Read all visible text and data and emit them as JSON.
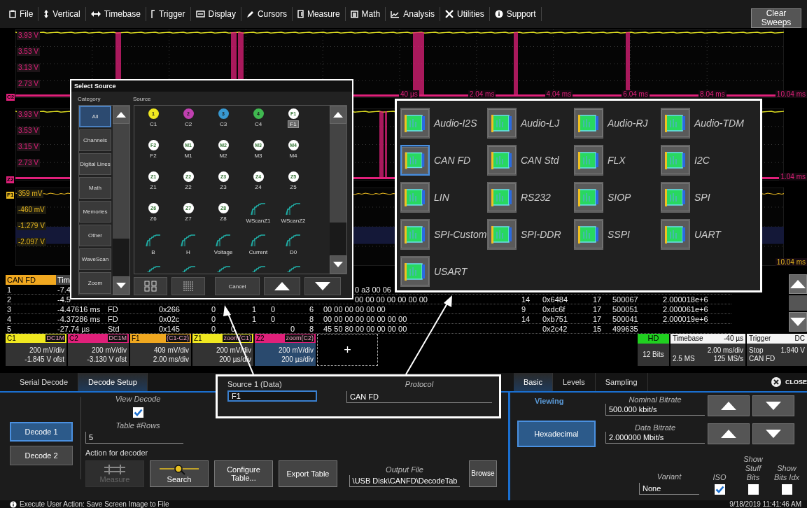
{
  "menu": {
    "items": [
      {
        "label": "File"
      },
      {
        "label": "Vertical"
      },
      {
        "label": "Timebase"
      },
      {
        "label": "Trigger"
      },
      {
        "label": "Display"
      },
      {
        "label": "Cursors"
      },
      {
        "label": "Measure"
      },
      {
        "label": "Math"
      },
      {
        "label": "Analysis"
      },
      {
        "label": "Utilities"
      },
      {
        "label": "Support"
      }
    ],
    "clear_button": "Clear Sweeps"
  },
  "scope": {
    "grids": [
      {
        "marker": "C2",
        "color": "#e0207a",
        "levels": [
          "3.93 V",
          "3.53 V",
          "3.13 V",
          "2.73 V"
        ],
        "time_labels": [
          "40 µs",
          "2.04 ms",
          "4.04 ms",
          "6.04 ms",
          "8.04 ms",
          "10.04 ms"
        ]
      },
      {
        "marker": "Z2",
        "color": "#e0207a",
        "levels": [
          "3.93 V",
          "3.53 V",
          "3.15 V",
          "2.73 V"
        ],
        "time_labels": [
          "1.04 ms"
        ]
      },
      {
        "marker": "F1",
        "color": "#e8b820",
        "levels": [
          "359 mV",
          "-460 mV",
          "-1.279 V",
          "-2.097 V"
        ],
        "time_labels": [
          "10.04 ms"
        ]
      }
    ]
  },
  "decode_table": {
    "columns": [
      "CAN FD",
      "Tim"
    ],
    "rows": [
      {
        "column_1": "1",
        "column_2": "-7.4",
        "column_11": "0 a3 00 06",
        "partly_covered": true
      },
      {
        "column_1": "2",
        "column_2": "-4.5",
        "column_11": "00 00 00 00 00 00 00",
        "column_12": "14",
        "column_13": "0x6484",
        "column_14": "17",
        "column_15": "500067",
        "column_16": "2.000018e+6",
        "partly_covered": true
      },
      {
        "column_1": "3",
        "column_2": "-4.47616 ms",
        "column_3": "FD",
        "column_4": "0x266",
        "column_5": "0",
        "column_7": "1",
        "column_8": "0",
        "column_10": "6",
        "column_11": "00 00 00 00 00 00",
        "column_12": "9",
        "column_13": "0xdc6f",
        "column_14": "17",
        "column_15": "500051",
        "column_16": "2.000061e+6",
        "partly_covered": false
      },
      {
        "column_1": "4",
        "column_2": "-4.37286 ms",
        "column_3": "FD",
        "column_4": "0x02c",
        "column_5": "0",
        "column_7": "1",
        "column_8": "0",
        "column_10": "8",
        "column_11": "00 00 00 00 00 00 00 00",
        "column_12": "14",
        "column_13": "0xb751",
        "column_14": "17",
        "column_15": "500041",
        "column_16": "2.000019e+6",
        "partly_covered": false
      },
      {
        "column_1": "5",
        "column_2": "-27.74 µs",
        "column_3": "Std",
        "column_4": "0x145",
        "column_5": "0",
        "column_6": "0",
        "column_9": "0",
        "column_10": "8",
        "column_11": "45 50 80 00 00 00 00 00",
        "column_13": "0x2c42",
        "column_14": "15",
        "column_15": "499635",
        "partly_covered": false
      }
    ]
  },
  "traces": [
    {
      "label": "C1",
      "tag": "DC1M",
      "lines": [
        "200 mV/div",
        "-1.845 V ofst"
      ],
      "color": "#f0e820",
      "selected": false
    },
    {
      "label": "C2",
      "tag": "DC1M",
      "lines": [
        "200 mV/div",
        "-3.130 V ofst"
      ],
      "color": "#e0207a",
      "selected": false
    },
    {
      "label": "F1",
      "tag": "(C1-C2)",
      "lines": [
        "409 mV/div",
        "2.00 ms/div"
      ],
      "color": "#f0a820",
      "selected": false
    },
    {
      "label": "Z1",
      "tag": "zoom(C1)",
      "lines": [
        "200 mV/div",
        "200 µs/div"
      ],
      "color": "#f0e820",
      "selected": false
    },
    {
      "label": "Z2",
      "tag": "zoom(C2)",
      "lines": [
        "200 mV/div",
        "200 µs/div"
      ],
      "color": "#e0207a",
      "selected": true
    }
  ],
  "add_trace": "+",
  "acquisition": {
    "mode": "HD",
    "bits": "12 Bits"
  },
  "timebase": {
    "title": "Timebase",
    "delay": "-40 µs",
    "div": "2.00 ms/div",
    "samples": "2.5 MS",
    "rate": "125 MS/s"
  },
  "trigger": {
    "title": "Trigger",
    "coupling": "DC",
    "state": "Stop",
    "level": "1.940 V",
    "type": "CAN FD"
  },
  "select_source": {
    "title": "Select Source",
    "category_heading": "Category",
    "source_heading": "Source",
    "categories": [
      {
        "label": "All",
        "selected": true
      },
      {
        "label": "Channels",
        "selected": false
      },
      {
        "label": "Digital Lines",
        "selected": false
      },
      {
        "label": "Math",
        "selected": false
      },
      {
        "label": "Memories",
        "selected": false
      },
      {
        "label": "Other",
        "selected": false
      },
      {
        "label": "WaveScan",
        "selected": false
      },
      {
        "label": "Zoom",
        "selected": false
      }
    ],
    "sources": [
      {
        "kind": "badge",
        "badge": "1",
        "label": "C1",
        "color": "#f0e820",
        "selected": false
      },
      {
        "kind": "badge",
        "badge": "2",
        "label": "C2",
        "color": "#c040b0",
        "selected": false
      },
      {
        "kind": "badge",
        "badge": "3",
        "label": "C3",
        "color": "#3898d0",
        "selected": false
      },
      {
        "kind": "badge",
        "badge": "4",
        "label": "C4",
        "color": "#40b850",
        "selected": false
      },
      {
        "kind": "badge",
        "badge": "F1",
        "label": "F1",
        "color": "#ffffff",
        "selected": true
      },
      {
        "kind": "badge",
        "badge": "F2",
        "label": "F2",
        "color": "#ffffff",
        "selected": false
      },
      {
        "kind": "badge",
        "badge": "M1",
        "label": "M1",
        "color": "#ffffff",
        "selected": false
      },
      {
        "kind": "badge",
        "badge": "M2",
        "label": "M2",
        "color": "#ffffff",
        "selected": false
      },
      {
        "kind": "badge",
        "badge": "M3",
        "label": "M3",
        "color": "#ffffff",
        "selected": false
      },
      {
        "kind": "badge",
        "badge": "M4",
        "label": "M4",
        "color": "#ffffff",
        "selected": false
      },
      {
        "kind": "badge",
        "badge": "Z1",
        "label": "Z1",
        "color": "#ffffff",
        "selected": false
      },
      {
        "kind": "badge",
        "badge": "Z2",
        "label": "Z2",
        "color": "#ffffff",
        "selected": false
      },
      {
        "kind": "badge",
        "badge": "Z3",
        "label": "Z3",
        "color": "#ffffff",
        "selected": false
      },
      {
        "kind": "badge",
        "badge": "Z4",
        "label": "Z4",
        "color": "#ffffff",
        "selected": false
      },
      {
        "kind": "badge",
        "badge": "Z5",
        "label": "Z5",
        "color": "#ffffff",
        "selected": false
      },
      {
        "kind": "badge",
        "badge": "Z6",
        "label": "Z6",
        "color": "#ffffff",
        "selected": false
      },
      {
        "kind": "badge",
        "badge": "Z7",
        "label": "Z7",
        "color": "#ffffff",
        "selected": false
      },
      {
        "kind": "badge",
        "badge": "Z8",
        "label": "Z8",
        "color": "#ffffff",
        "selected": false
      },
      {
        "kind": "wave",
        "label": "WScanZ1",
        "selected": false
      },
      {
        "kind": "wave",
        "label": "WScanZ2",
        "selected": false
      },
      {
        "kind": "wave",
        "label": "B",
        "selected": false
      },
      {
        "kind": "wave",
        "label": "H",
        "selected": false
      },
      {
        "kind": "wave",
        "label": "Voltage",
        "selected": false
      },
      {
        "kind": "wave",
        "label": "Current",
        "selected": false
      },
      {
        "kind": "wave",
        "label": "D0",
        "selected": false
      },
      {
        "kind": "wave",
        "selected": false
      },
      {
        "kind": "wave",
        "selected": false
      },
      {
        "kind": "wave",
        "selected": false
      },
      {
        "kind": "wave",
        "selected": false
      },
      {
        "kind": "wave",
        "selected": false
      }
    ],
    "cancel_button": "Cancel"
  },
  "protocols": [
    {
      "label": "Audio-I2S",
      "selected": false
    },
    {
      "label": "Audio-LJ",
      "selected": false
    },
    {
      "label": "Audio-RJ",
      "selected": false
    },
    {
      "label": "Audio-TDM",
      "selected": false
    },
    {
      "label": "CAN FD",
      "selected": true
    },
    {
      "label": "CAN Std",
      "selected": false
    },
    {
      "label": "FLX",
      "selected": false
    },
    {
      "label": "I2C",
      "selected": false
    },
    {
      "label": "LIN",
      "selected": false
    },
    {
      "label": "RS232",
      "selected": false
    },
    {
      "label": "SIOP",
      "selected": false
    },
    {
      "label": "SPI",
      "selected": false
    },
    {
      "label": "SPI-Custom",
      "selected": false
    },
    {
      "label": "SPI-DDR",
      "selected": false
    },
    {
      "label": "SSPI",
      "selected": false
    },
    {
      "label": "UART",
      "selected": false
    },
    {
      "label": "USART",
      "selected": false
    }
  ],
  "decode_panel": {
    "tabs": [
      {
        "label": "Serial Decode",
        "selected": false
      },
      {
        "label": "Decode Setup",
        "selected": true
      }
    ],
    "decoders": [
      {
        "label": "Decode 1",
        "selected": true
      },
      {
        "label": "Decode 2",
        "selected": false
      }
    ],
    "view_decode": {
      "label": "View Decode",
      "checked": true
    },
    "table_rows": {
      "label": "Table #Rows",
      "value": "5"
    },
    "action_label": "Action for decoder",
    "actions": [
      {
        "label": "Measure",
        "disabled": true
      },
      {
        "label": "Search",
        "disabled": false
      },
      {
        "label": "Configure Table...",
        "disabled": false
      },
      {
        "label": "Export Table",
        "disabled": false
      }
    ],
    "output_file": {
      "label": "Output File",
      "value": "\\USB Disk\\CANFD\\DecodeTab"
    },
    "browse_button": "Browse",
    "callout": {
      "source": {
        "label": "Source 1 (Data)",
        "value": "F1"
      },
      "protocol": {
        "label": "Protocol",
        "value": "CAN FD"
      }
    }
  },
  "settings_panel": {
    "tabs": [
      {
        "label": "Basic",
        "selected": true
      },
      {
        "label": "Levels",
        "selected": false
      },
      {
        "label": "Sampling",
        "selected": false
      }
    ],
    "close_button": "CLOSE",
    "viewing_label": "Viewing",
    "format_button": {
      "label": "Hexadecimal",
      "selected": true
    },
    "bitrates": [
      {
        "label": "Nominal Bitrate",
        "value": "500.000 kbit/s"
      },
      {
        "label": "Data Bitrate",
        "value": "2.000000 Mbit/s"
      }
    ],
    "variant": {
      "label": "Variant",
      "value": "None"
    },
    "options": [
      {
        "label": "ISO",
        "checked": true
      },
      {
        "label": "Show Stuff Bits",
        "checked": false
      },
      {
        "label": "Show Bits Idx",
        "checked": false
      }
    ]
  },
  "status_bar": {
    "message": "Execute User Action: Save Screen Image to File",
    "datetime": "9/18/2019 11:41:46 AM"
  }
}
